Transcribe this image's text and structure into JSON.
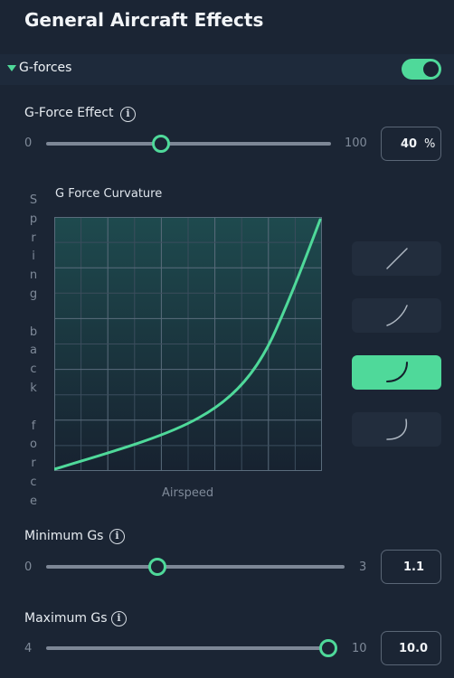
{
  "header": {
    "title": "General Aircraft Effects"
  },
  "section": {
    "label": "G-forces",
    "expanded": true,
    "enabled": true
  },
  "g_force_effect": {
    "label": "G-Force Effect",
    "min_label": "0",
    "max_label": "100",
    "value": "40",
    "unit": "%",
    "min": 0,
    "max": 100,
    "current": 40
  },
  "curvature": {
    "title": "G Force Curvature",
    "ylabel_text": "S\np\nr\ni\nn\ng\n\nb\na\nc\nk\n\nf\no\nr\nc\ne",
    "xlabel": "Airspeed",
    "presets": [
      {
        "name": "linear",
        "selected": false
      },
      {
        "name": "slight-curve",
        "selected": false
      },
      {
        "name": "moderate-curve",
        "selected": true
      },
      {
        "name": "strong-curve",
        "selected": false
      }
    ]
  },
  "minimum_gs": {
    "label": "Minimum Gs",
    "min_label": "0",
    "max_label": "3",
    "value": "1.1",
    "min": 0,
    "max": 3,
    "current": 1.1
  },
  "maximum_gs": {
    "label": "Maximum Gs",
    "min_label": "4",
    "max_label": "10",
    "value": "10.0",
    "min": 4,
    "max": 10,
    "current": 10.0
  },
  "colors": {
    "accent": "#4fd99a",
    "background": "#1b2534",
    "panel": "#222d3d"
  }
}
